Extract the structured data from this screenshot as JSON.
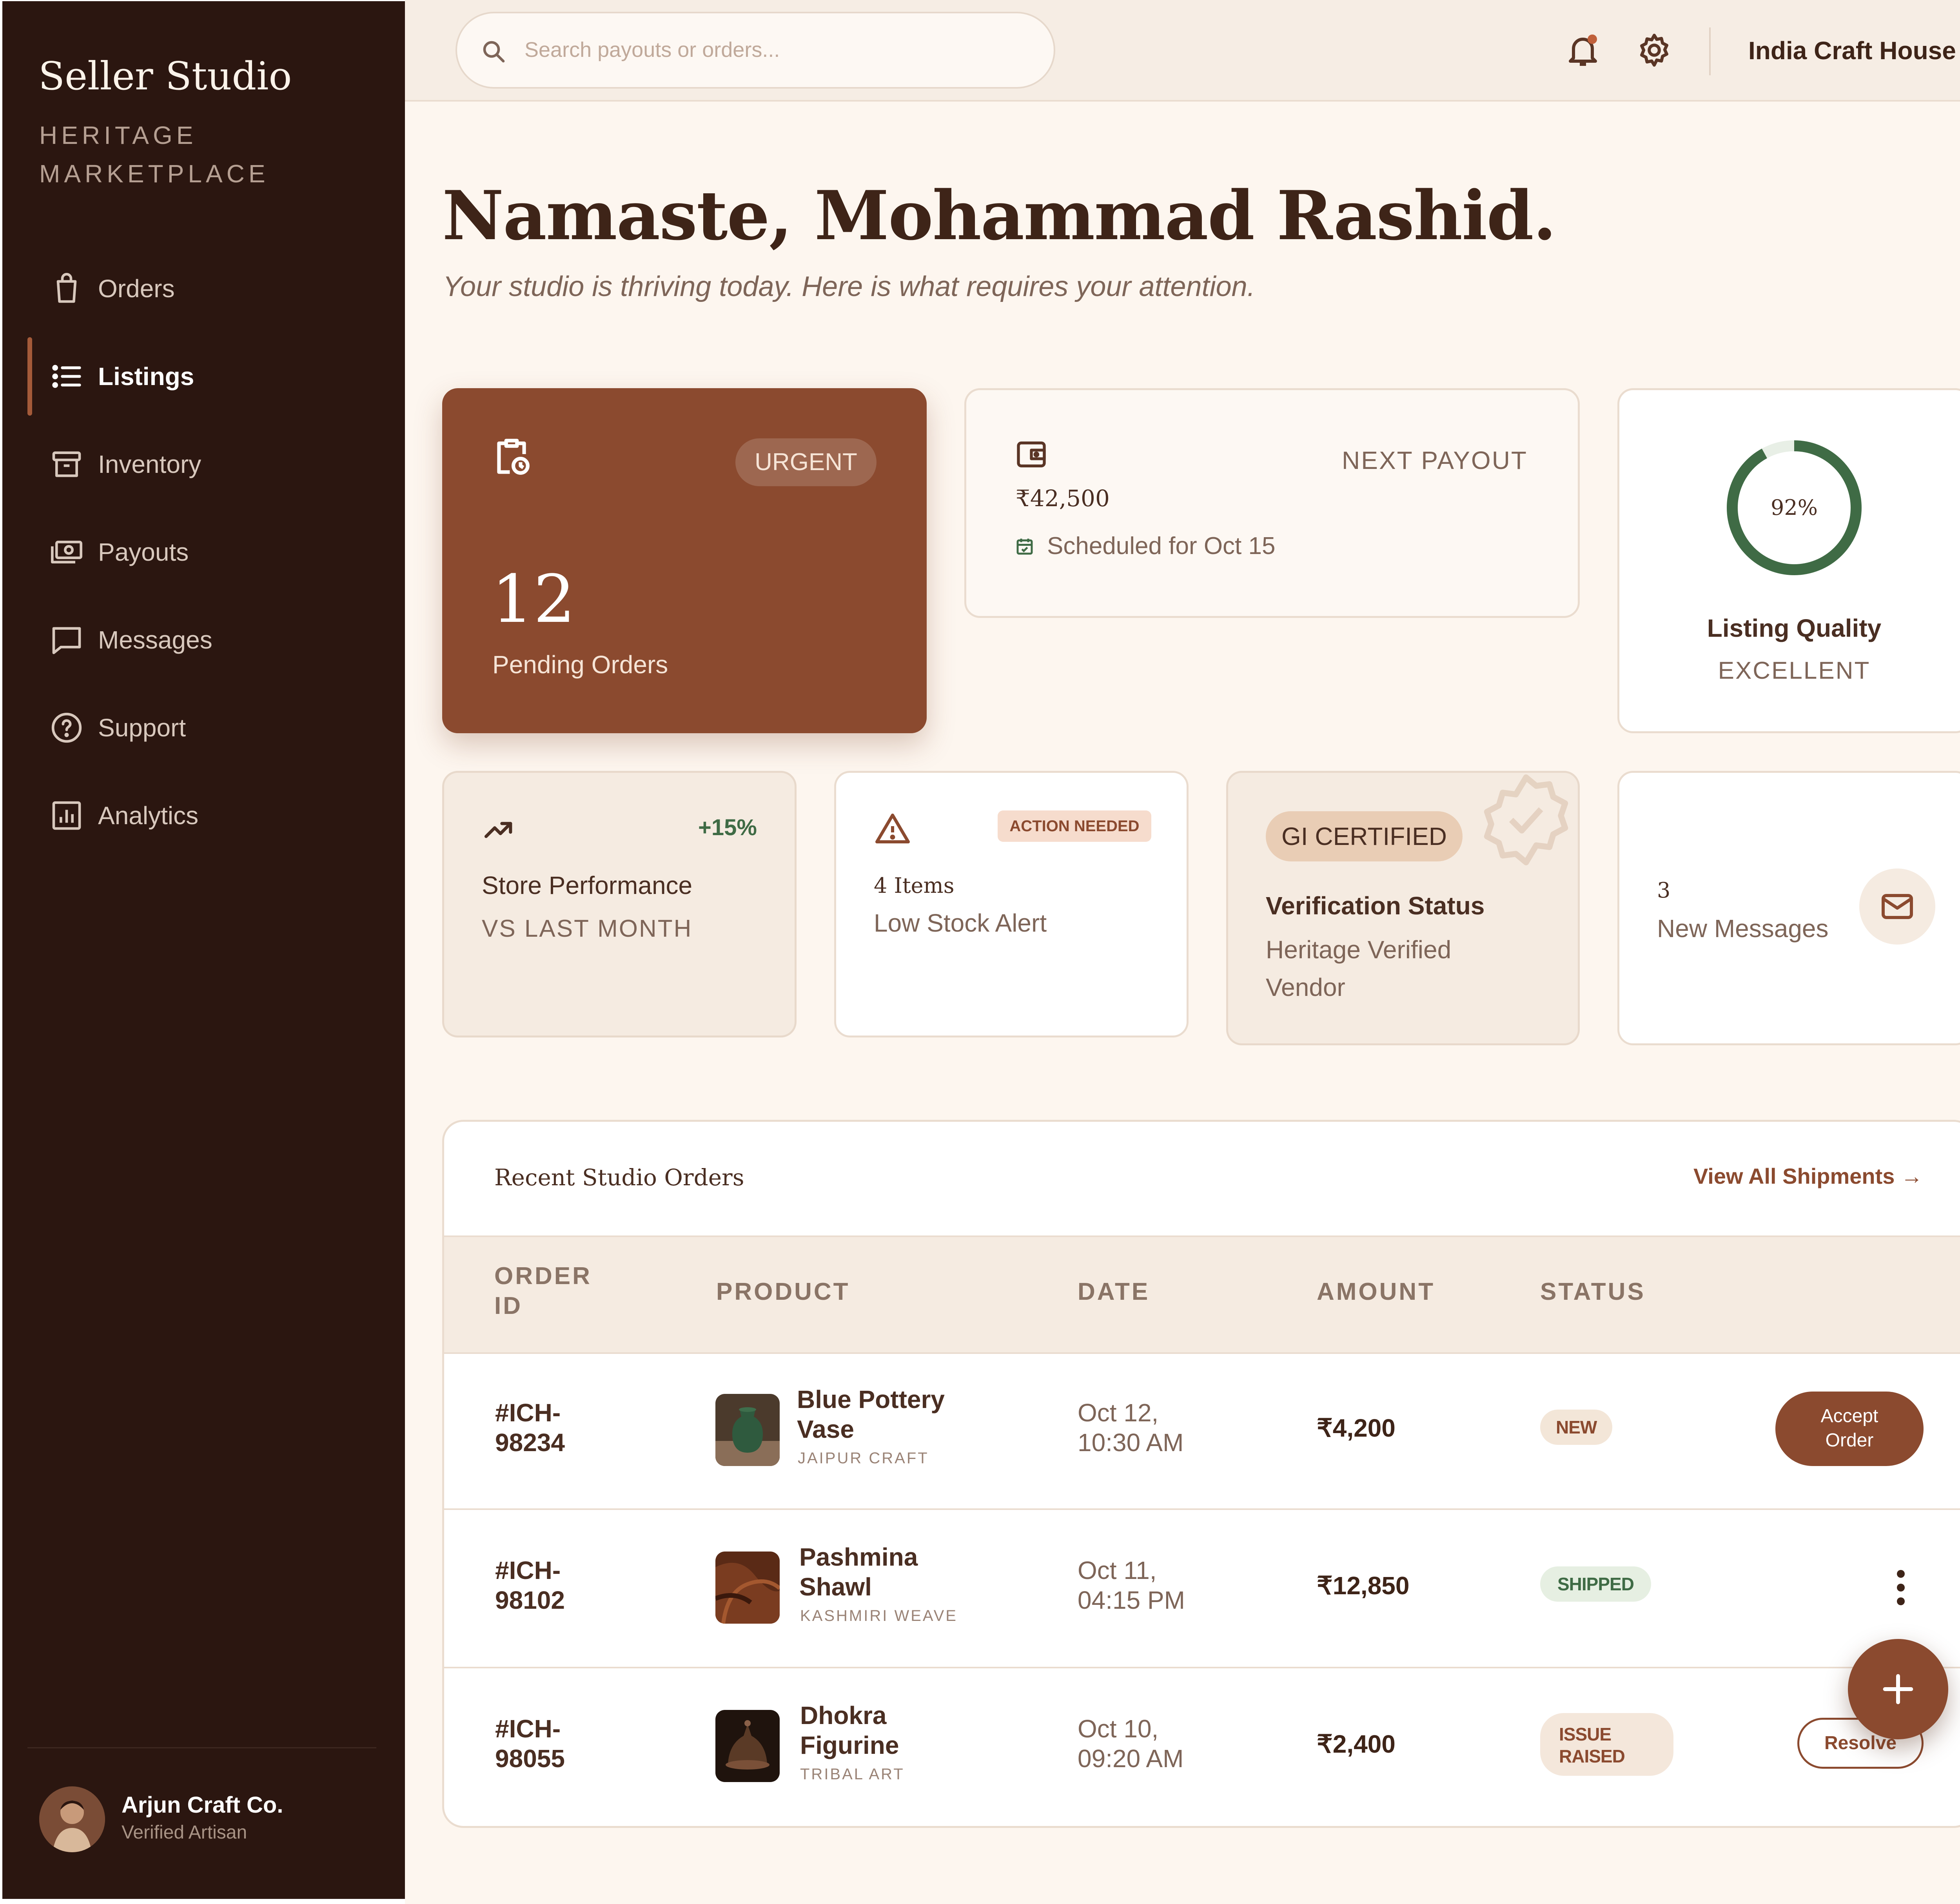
{
  "brand": {
    "title": "Seller Studio",
    "subtitle": "HERITAGE MARKETPLACE"
  },
  "nav": {
    "items": [
      {
        "label": "Orders",
        "icon": "shopping-bag-icon"
      },
      {
        "label": "Listings",
        "icon": "list-icon",
        "active": true
      },
      {
        "label": "Inventory",
        "icon": "archive-icon"
      },
      {
        "label": "Payouts",
        "icon": "banknote-icon"
      },
      {
        "label": "Messages",
        "icon": "chat-icon"
      },
      {
        "label": "Support",
        "icon": "help-circle-icon"
      },
      {
        "label": "Analytics",
        "icon": "bar-chart-icon"
      }
    ]
  },
  "user": {
    "name": "Arjun Craft Co.",
    "role": "Verified Artisan"
  },
  "topbar": {
    "search_placeholder": "Search payouts or orders...",
    "store_name": "India Craft House",
    "icons": [
      "bell-icon",
      "gear-icon"
    ]
  },
  "greeting": {
    "title": "Namaste, Mohammad Rashid.",
    "subtitle": "Your studio is thriving today. Here is what requires your attention."
  },
  "cards": {
    "urgent": {
      "badge": "URGENT",
      "value": "12",
      "label": "Pending Orders"
    },
    "payout": {
      "label": "NEXT PAYOUT",
      "amount": "₹42,500",
      "scheduled": "Scheduled for Oct 15"
    },
    "quality": {
      "percent_text": "92%",
      "percent": 92,
      "title": "Listing Quality",
      "rating": "EXCELLENT"
    },
    "performance": {
      "change": "+15%",
      "title": "Store Performance",
      "subtitle": "VS LAST MONTH"
    },
    "stock": {
      "badge": "ACTION NEEDED",
      "count": "4 Items",
      "label": "Low Stock Alert"
    },
    "gi": {
      "badge": "GI CERTIFIED",
      "title": "Verification Status",
      "line1": "Heritage Verified",
      "line2": "Vendor"
    },
    "messages": {
      "count": "3",
      "label": "New Messages"
    }
  },
  "orders": {
    "title": "Recent Studio Orders",
    "view_all": "View All Shipments →",
    "headers": {
      "order_id_1": "ORDER",
      "order_id_2": "ID",
      "product": "PRODUCT",
      "date": "DATE",
      "amount": "AMOUNT",
      "status": "STATUS"
    },
    "rows": [
      {
        "id1": "#ICH-",
        "id2": "98234",
        "name1": "Blue Pottery",
        "name2": "Vase",
        "category": "JAIPUR CRAFT",
        "date1": "Oct 12,",
        "date2": "10:30 AM",
        "amount": "₹4,200",
        "status": "NEW",
        "action": "Accept Order",
        "action1": "Accept",
        "action2": "Order"
      },
      {
        "id1": "#ICH-",
        "id2": "98102",
        "name1": "Pashmina",
        "name2": "Shawl",
        "category": "KASHMIRI WEAVE",
        "date1": "Oct 11,",
        "date2": "04:15 PM",
        "amount": "₹12,850",
        "status": "SHIPPED",
        "action": ""
      },
      {
        "id1": "#ICH-",
        "id2": "98055",
        "name1": "Dhokra",
        "name2": "Figurine",
        "category": "TRIBAL ART",
        "date1": "Oct 10,",
        "date2": "09:20 AM",
        "amount": "₹2,400",
        "status1": "ISSUE",
        "status2": "RAISED",
        "action": "Resolve"
      }
    ]
  },
  "colors": {
    "sidebar": "#2b1610",
    "accent": "#8b4a2f",
    "background": "#fdf6ef",
    "success": "#3f6b45",
    "new_badge": "#f3e6d8",
    "shipped_badge": "#e6efe2",
    "issue_badge": "#f4e7db"
  }
}
